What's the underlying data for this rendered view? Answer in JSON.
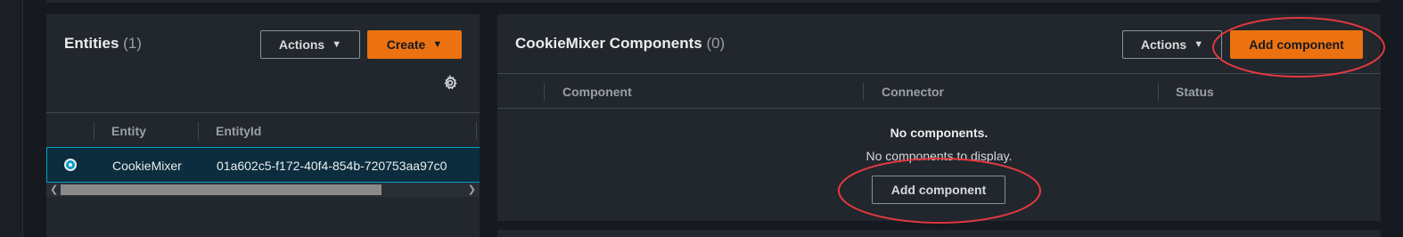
{
  "entities_panel": {
    "title": "Entities",
    "count": "(1)",
    "actions_label": "Actions",
    "create_label": "Create",
    "columns": [
      "Entity",
      "EntityId"
    ],
    "rows": [
      {
        "entity": "CookieMixer",
        "entity_id": "01a602c5-f172-40f4-854b-720753aa97c0",
        "selected": true
      }
    ]
  },
  "components_panel": {
    "title": "CookieMixer Components",
    "count": "(0)",
    "actions_label": "Actions",
    "add_component_label": "Add component",
    "columns": [
      "Component",
      "Connector",
      "Status"
    ],
    "empty_title": "No components.",
    "empty_description": "No components to display.",
    "empty_add_label": "Add component"
  },
  "icons": {
    "settings": "gear-icon",
    "caret": "caret-down-icon",
    "scroll_left": "chevron-left-icon",
    "scroll_right": "chevron-right-icon"
  },
  "colors": {
    "primary": "#ec7211",
    "selection": "#00a1c9",
    "annotation": "#e0393e"
  }
}
